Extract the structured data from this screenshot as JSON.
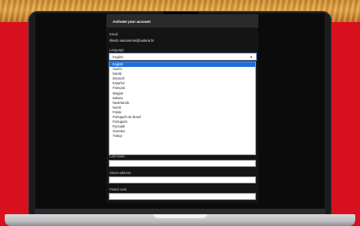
{
  "panel": {
    "title": "Activate your account",
    "email_label": "Email",
    "email_value": "lilovitz.maciamrnis@outlook.hr",
    "language_label": "Language",
    "language_selected": "English"
  },
  "language_options": [
    "English",
    "Suomi",
    "Dansk",
    "Deutsch",
    "Español",
    "Français",
    "Magyar",
    "Italiano",
    "Nederlands",
    "Norsk",
    "Polski",
    "Português do Brasil",
    "Português",
    "Русский",
    "Svenska",
    "Türkçe"
  ],
  "fields": {
    "last_name_label": "Last name",
    "street_address_label": "Street address",
    "postal_code_label": "Postal code"
  },
  "colors": {
    "background_red": "#d8101e",
    "selection_blue": "#1e6fd9"
  }
}
